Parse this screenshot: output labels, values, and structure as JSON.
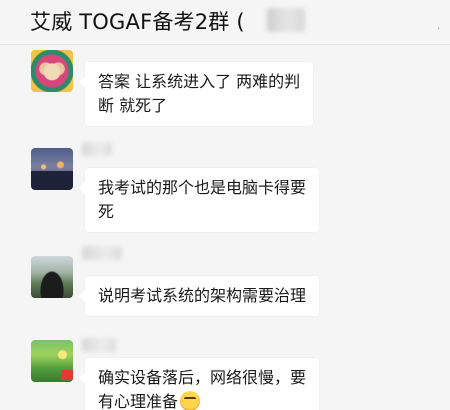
{
  "header": {
    "title": "艾威 TOGAF备考2群 (",
    "more_icon": "more-dots-icon",
    "more_glyph": "·"
  },
  "messages": [
    {
      "lines": [
        "答案 让系统进入了 两难的判",
        "断  就死了"
      ]
    },
    {
      "lines": [
        "我考试的那个也是电脑卡得要",
        "死"
      ]
    },
    {
      "lines": [
        "说明考试系统的架构需要治理"
      ]
    },
    {
      "lines": [
        "确实设备落后，网络很慢，要",
        "有心理准备"
      ],
      "emoji": "sweat-smile-emoji"
    }
  ],
  "colors": {
    "background": "#f5f5f5",
    "bubble": "#ffffff",
    "text": "#1a1a1a"
  }
}
